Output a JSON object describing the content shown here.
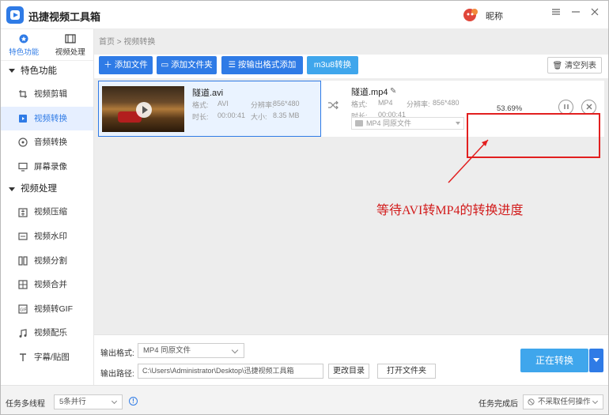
{
  "app": {
    "title": "迅捷视频工具箱",
    "user_name": "昵称",
    "window_controls": [
      "menu-icon",
      "minimize-icon",
      "close-icon"
    ]
  },
  "sidebar": {
    "top_tabs": [
      {
        "label": "特色功能",
        "icon": "star-icon",
        "active": true
      },
      {
        "label": "视频处理",
        "icon": "film-icon",
        "active": false
      }
    ],
    "groups": [
      {
        "label": "特色功能",
        "items": [
          {
            "label": "视频剪辑",
            "icon": "crop-icon",
            "active": false
          },
          {
            "label": "视频转换",
            "icon": "video-convert-icon",
            "active": true
          },
          {
            "label": "音频转换",
            "icon": "audio-icon",
            "active": false
          },
          {
            "label": "屏幕录像",
            "icon": "screen-record-icon",
            "active": false
          }
        ]
      },
      {
        "label": "视频处理",
        "items": [
          {
            "label": "视频压缩",
            "icon": "compress-icon",
            "active": false
          },
          {
            "label": "视频水印",
            "icon": "watermark-icon",
            "active": false
          },
          {
            "label": "视频分割",
            "icon": "split-icon",
            "active": false
          },
          {
            "label": "视频合并",
            "icon": "merge-icon",
            "active": false
          },
          {
            "label": "视频转GIF",
            "icon": "gif-icon",
            "active": false
          },
          {
            "label": "视频配乐",
            "icon": "music-icon",
            "active": false
          },
          {
            "label": "字幕/贴图",
            "icon": "subtitle-icon",
            "active": false
          }
        ]
      }
    ]
  },
  "breadcrumb": {
    "home": "首页",
    "separator": ">",
    "current": "视频转换"
  },
  "toolbar": {
    "add_file": "添加文件",
    "add_folder": "添加文件夹",
    "by_output_format": "按输出格式添加",
    "m3u8": "m3u8转换",
    "clear_list": "清空列表"
  },
  "file": {
    "source": {
      "name": "隧道.avi",
      "format_label": "格式:",
      "format": "AVI",
      "resolution_label": "分辨率:",
      "resolution": "856*480",
      "duration_label": "时长:",
      "duration": "00:00:41",
      "size_label": "大小:",
      "size": "8.35 MB"
    },
    "target": {
      "name": "隧道.mp4",
      "format_label": "格式:",
      "format": "MP4",
      "resolution_label": "分辨率:",
      "resolution": "856*480",
      "duration_label": "时长:",
      "duration": "00:00:41",
      "output_select": "MP4  同原文件"
    },
    "progress_text": "53.69%",
    "progress_value": 53.69
  },
  "annotation": {
    "text": "等待AVI转MP4的转换进度",
    "color": "#d21c1c"
  },
  "bottom": {
    "format_label": "输出格式:",
    "format_value": "MP4  同原文件",
    "path_label": "输出路径:",
    "path_value": "C:\\Users\\Administrator\\Desktop\\迅捷视频工具箱",
    "change_dir": "更改目录",
    "open_folder": "打开文件夹",
    "convert_button": "正在转换"
  },
  "statusbar": {
    "multi_thread_label": "任务多线程",
    "multi_thread_value": "5条并行",
    "after_done_label": "任务完成后",
    "after_done_value": "不采取任何操作"
  },
  "colors": {
    "accent": "#2f7be6",
    "accent_light": "#3fa6ec",
    "highlight": "#e21f1f"
  }
}
